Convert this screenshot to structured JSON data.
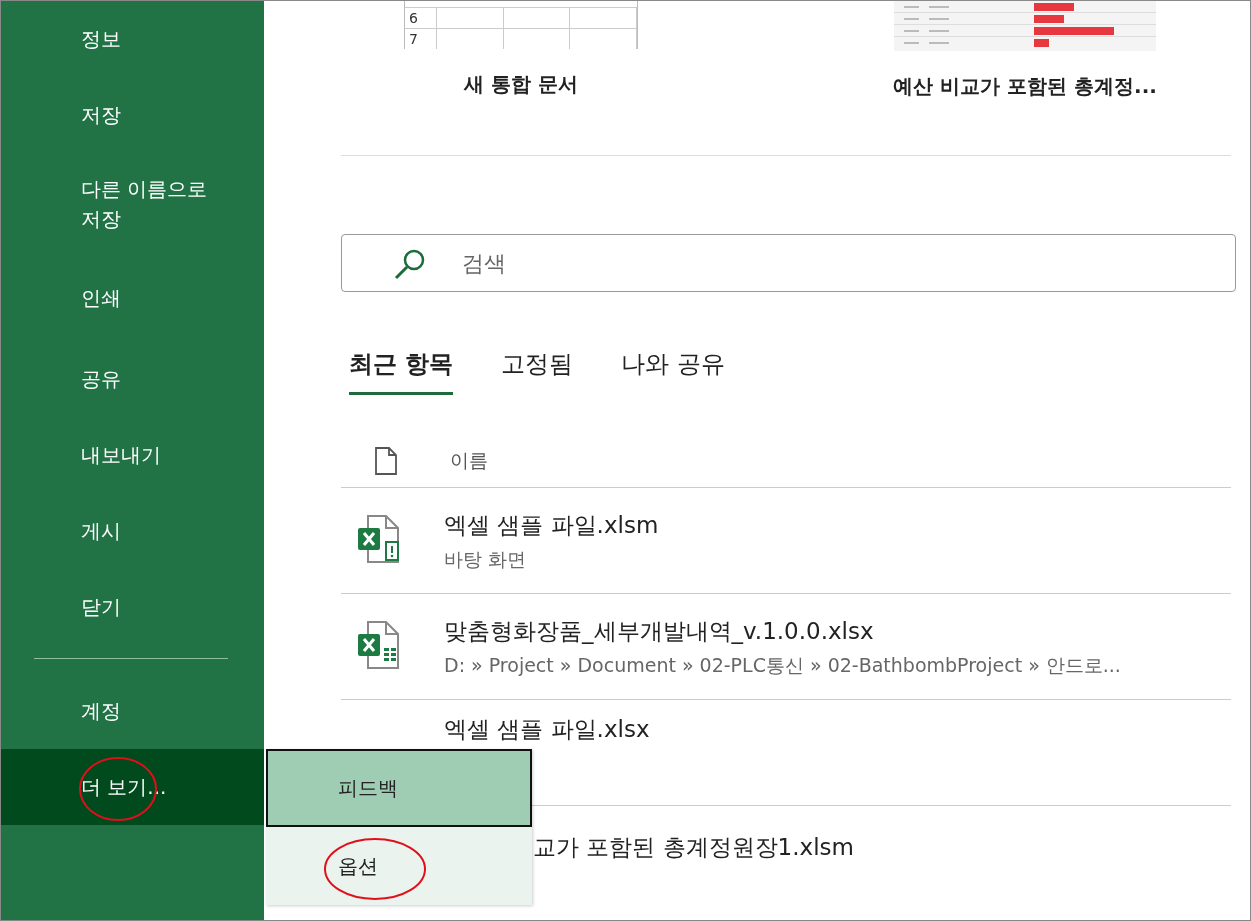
{
  "sidebar": {
    "items": [
      {
        "label": "정보",
        "selected": false
      },
      {
        "label": "저장",
        "selected": false
      },
      {
        "label": "다른 이름으로 저장",
        "selected": false
      },
      {
        "label": "인쇄",
        "selected": false
      },
      {
        "label": "공유",
        "selected": false
      },
      {
        "label": "내보내기",
        "selected": false
      },
      {
        "label": "게시",
        "selected": false
      },
      {
        "label": "닫기",
        "selected": false
      }
    ],
    "bottom_items": [
      {
        "label": "계정",
        "selected": false
      },
      {
        "label": "더 보기...",
        "selected": true
      }
    ]
  },
  "templates": [
    {
      "kind": "blank",
      "title": "새 통합 문서",
      "row_numbers": [
        "6",
        "7"
      ]
    },
    {
      "kind": "budget",
      "title": "예산 비교가 포함된 총계정..."
    }
  ],
  "search": {
    "placeholder": "검색"
  },
  "tabs": [
    {
      "label": "최근 항목",
      "selected": true
    },
    {
      "label": "고정됨",
      "selected": false
    },
    {
      "label": "나와 공유",
      "selected": false
    }
  ],
  "file_list": {
    "column": "이름",
    "files": [
      {
        "kind": "macro",
        "name": "엑셀 샘플 파일.xlsm",
        "location": "바탕 화면"
      },
      {
        "kind": "workbook",
        "name": "맞춤형화장품_세부개발내역_v.1.0.0.xlsx",
        "location": "D: » Project » Document » 02-PLC통신 » 02-BathbombProject » 안드로..."
      },
      {
        "kind": "covered",
        "name": "엑셀 샘플 파일.xlsx"
      },
      {
        "kind": "covered-right",
        "name": "교가 포함된 총계정원장1.xlsm"
      }
    ]
  },
  "popup_menu": {
    "items": [
      {
        "label": "피드백",
        "selected": true
      },
      {
        "label": "옵션",
        "selected": false
      }
    ]
  }
}
